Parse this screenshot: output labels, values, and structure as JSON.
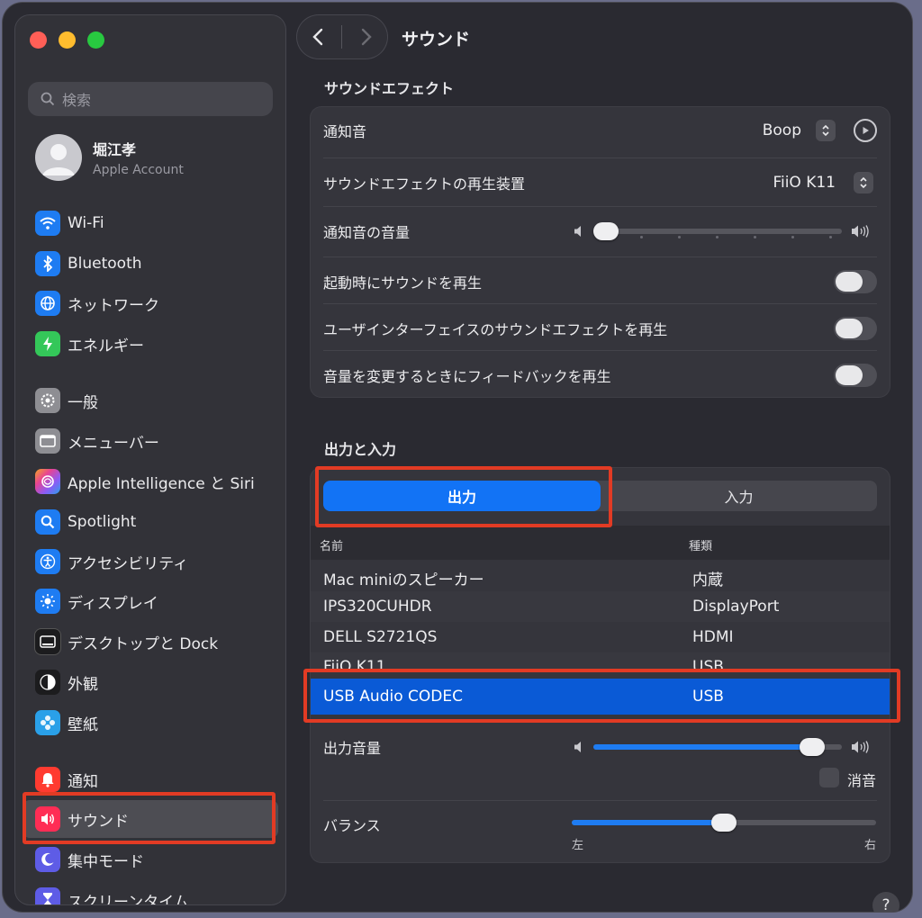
{
  "sidebar": {
    "search_placeholder": "検索",
    "account": {
      "name": "堀江孝",
      "subtitle": "Apple Account"
    },
    "items": [
      {
        "label": "Wi-Fi",
        "icon": "wifi-icon",
        "color": "#1e7cf2"
      },
      {
        "label": "Bluetooth",
        "icon": "bluetooth-icon",
        "color": "#1e7cf2"
      },
      {
        "label": "ネットワーク",
        "icon": "globe-icon",
        "color": "#1e7cf2"
      },
      {
        "label": "エネルギー",
        "icon": "battery-bolt-icon",
        "color": "#34c759"
      },
      {
        "label": "一般",
        "icon": "gear-icon",
        "color": "#8e8e93"
      },
      {
        "label": "メニューバー",
        "icon": "menubar-icon",
        "color": "#8e8e93"
      },
      {
        "label": "Apple Intelligence と Siri",
        "icon": "siri-icon",
        "color": "#b05cf0"
      },
      {
        "label": "Spotlight",
        "icon": "magnifier-icon",
        "color": "#1e7cf2"
      },
      {
        "label": "アクセシビリティ",
        "icon": "accessibility-icon",
        "color": "#1e7cf2"
      },
      {
        "label": "ディスプレイ",
        "icon": "sun-icon",
        "color": "#1e7cf2"
      },
      {
        "label": "デスクトップと Dock",
        "icon": "dock-icon",
        "color": "#1c1c1e"
      },
      {
        "label": "外観",
        "icon": "appearance-icon",
        "color": "#1c1c1e"
      },
      {
        "label": "壁紙",
        "icon": "wallpaper-icon",
        "color": "#2aa0e8"
      },
      {
        "label": "通知",
        "icon": "bell-icon",
        "color": "#ff3b30"
      },
      {
        "label": "サウンド",
        "icon": "speaker-icon",
        "color": "#ff2d55"
      },
      {
        "label": "集中モード",
        "icon": "moon-icon",
        "color": "#5e5ce6"
      },
      {
        "label": "スクリーンタイム",
        "icon": "hourglass-icon",
        "color": "#5e5ce6"
      }
    ]
  },
  "header": {
    "title": "サウンド"
  },
  "sound_effects": {
    "section_title": "サウンドエフェクト",
    "alert_sound": {
      "label": "通知音",
      "value": "Boop"
    },
    "play_through": {
      "label": "サウンドエフェクトの再生装置",
      "value": "FiiO K11"
    },
    "alert_volume": {
      "label": "通知音の音量",
      "level": 0.04
    },
    "startup_sound": {
      "label": "起動時にサウンドを再生",
      "on": false
    },
    "ui_sound": {
      "label": "ユーザインターフェイスのサウンドエフェクトを再生",
      "on": false
    },
    "volume_feedback": {
      "label": "音量を変更するときにフィードバックを再生",
      "on": false
    }
  },
  "output_input": {
    "section_title": "出力と入力",
    "tabs": {
      "output": "出力",
      "input": "入力"
    },
    "columns": {
      "name": "名前",
      "type": "種類"
    },
    "devices": [
      {
        "name": "Mac miniのスピーカー",
        "type": "内蔵"
      },
      {
        "name": "IPS320CUHDR",
        "type": "DisplayPort"
      },
      {
        "name": "DELL S2721QS",
        "type": "HDMI"
      },
      {
        "name": "FiiO K11",
        "type": "USB"
      },
      {
        "name": "USB Audio CODEC",
        "type": "USB"
      }
    ],
    "output_volume": {
      "label": "出力音量",
      "level": 0.88
    },
    "mute": {
      "label": "消音",
      "checked": false
    },
    "balance": {
      "label": "バランス",
      "value": 0.5,
      "left": "左",
      "right": "右"
    }
  },
  "help": "?"
}
